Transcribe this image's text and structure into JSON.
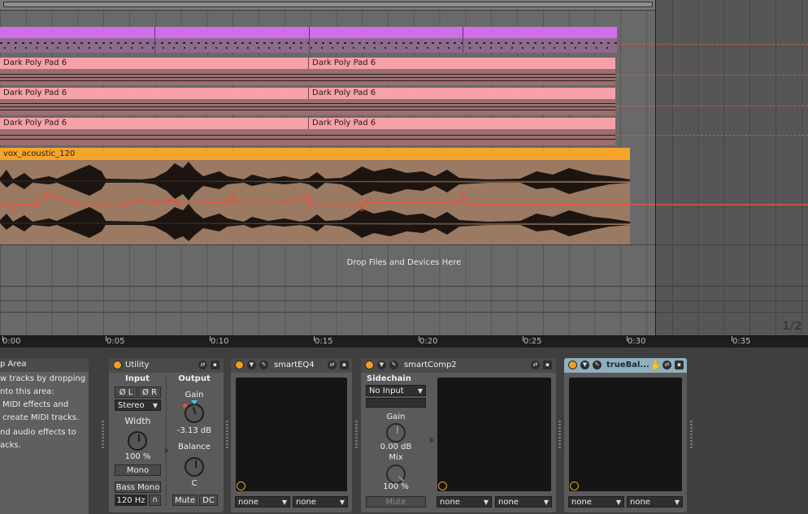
{
  "arrangement": {
    "clips": {
      "midi_top_label": "",
      "pad_label": "Dark Poly Pad 6",
      "audio_label": "vox_acoustic_120"
    },
    "drop_text": "Drop Files and Devices Here",
    "page_indicator": "1/2",
    "colors": {
      "purple": "#cf6ee8",
      "pink": "#f6a0a8",
      "orange": "#f5a52a",
      "automation": "#e9533f"
    }
  },
  "ruler": {
    "ticks": [
      "0:00",
      "0:05",
      "0:10",
      "0:15",
      "0:20",
      "0:25",
      "0:30",
      "0:35"
    ]
  },
  "help_panel": {
    "title": "p Area",
    "lines": [
      "w tracks by dropping",
      "nto this area:",
      "MIDI effects and",
      "create MIDI tracks.",
      "nd audio effects to",
      "acks."
    ]
  },
  "utility": {
    "title": "Utility",
    "input_label": "Input",
    "output_label": "Output",
    "phase_left": "Ø L",
    "phase_right": "Ø R",
    "channel_mode": "Stereo",
    "width_label": "Width",
    "width_value": "100 %",
    "mono_label": "Mono",
    "bass_mono_label": "Bass Mono",
    "bass_freq": "120 Hz",
    "gain_label": "Gain",
    "gain_value": "-3.13 dB",
    "balance_label": "Balance",
    "balance_value": "C",
    "mute_label": "Mute",
    "dc_label": "DC"
  },
  "smarteq": {
    "title": "smartEQ4",
    "select_left": "none",
    "select_right": "none"
  },
  "smartcomp": {
    "title": "smartComp2",
    "sidechain_label": "Sidechain",
    "sidechain_input": "No Input",
    "gain_label": "Gain",
    "gain_value": "0.00 dB",
    "mix_label": "Mix",
    "mix_value": "100 %",
    "mute_label": "Mute",
    "select_left": "none",
    "select_right": "none"
  },
  "truebalance": {
    "title": "trueBal...",
    "select_left": "none",
    "select_right": "none"
  }
}
